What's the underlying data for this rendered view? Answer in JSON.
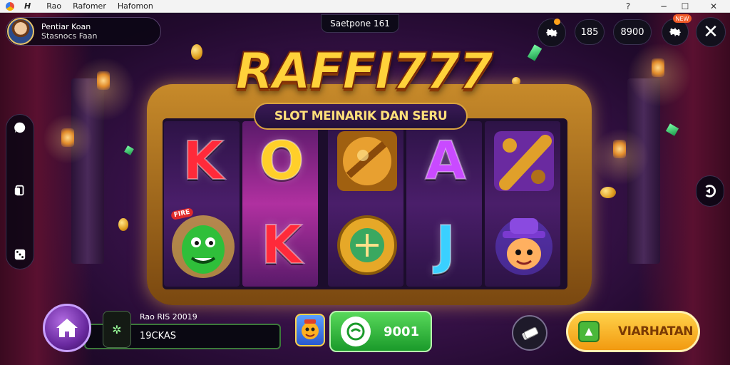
{
  "window": {
    "app_name": "H",
    "menu": [
      "Rao",
      "Rafomer",
      "Hafomon"
    ],
    "controls": [
      "−",
      "☐",
      "✕"
    ]
  },
  "profile": {
    "line1": "Pentiar Koan",
    "line2": "Stasnocs Faan"
  },
  "top_center_label": "Saetpone 161",
  "top_right": {
    "pill1": "185",
    "pill2": "8900",
    "badge": "NEW"
  },
  "game": {
    "title": "RAFFI777",
    "subtitle": "SLOT MEINARIK DAN SERU",
    "reels": [
      [
        {
          "type": "letter",
          "text": "K",
          "color": "#ff2a3a"
        },
        {
          "type": "image",
          "name": "green-monster",
          "tag": "FIRE"
        }
      ],
      [
        {
          "type": "letter",
          "text": "O",
          "color": "#ffcf2a"
        },
        {
          "type": "letter",
          "text": "K",
          "color": "#ff2a3a"
        }
      ],
      [
        {
          "type": "image",
          "name": "golden-ball"
        },
        {
          "type": "image",
          "name": "golden-compass"
        }
      ],
      [
        {
          "type": "letter",
          "text": "A",
          "color": "#c94aff"
        },
        {
          "type": "letter",
          "text": "J",
          "color": "#3ad0ff"
        }
      ],
      [
        {
          "type": "image",
          "name": "golden-cannon"
        },
        {
          "type": "image",
          "name": "hat-character"
        }
      ]
    ]
  },
  "bottom": {
    "balance_top": "Rao RIS 20019",
    "balance_bottom": "19CKAS",
    "spin_value": "9001",
    "action_label": "VIARHATAN"
  }
}
